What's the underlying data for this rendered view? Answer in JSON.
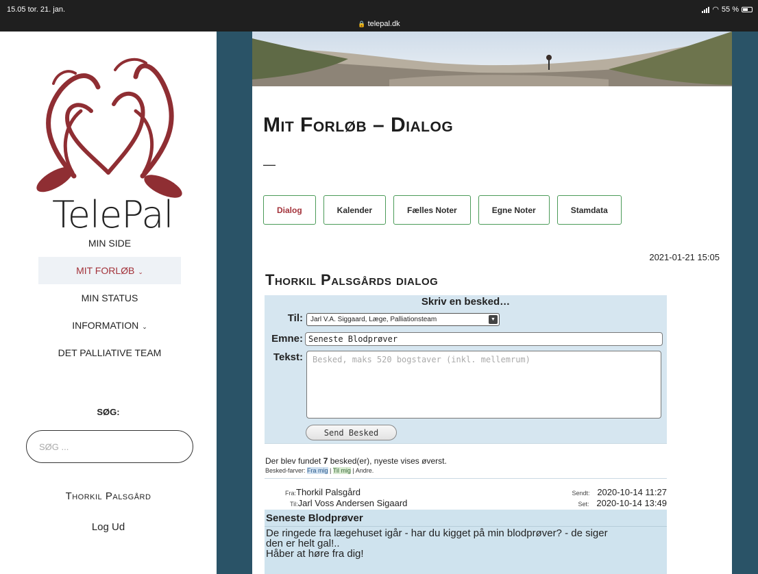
{
  "status_bar": {
    "time": "15.05  tor. 21. jan.",
    "url": "telepal.dk",
    "battery": "55 %"
  },
  "sidebar": {
    "logo_text": "TelePal",
    "nav": [
      {
        "label": "MIN SIDE"
      },
      {
        "label": "MIT FORLØB"
      },
      {
        "label": "MIN STATUS"
      },
      {
        "label": "INFORMATION"
      },
      {
        "label": "DET PALLIATIVE TEAM"
      }
    ],
    "search_label": "SØG:",
    "search_placeholder": "SØG ...",
    "user_name": "Thorkil Palsgård",
    "logout": "Log Ud"
  },
  "page": {
    "title": "Mit Forløb – Dialog",
    "dash": "—",
    "tabs": [
      "Dialog",
      "Kalender",
      "Fælles Noter",
      "Egne Noter",
      "Stamdata"
    ],
    "datetime": "2021-01-21 15:05",
    "dialog_title": "Thorkil Palsgårds dialog"
  },
  "form": {
    "heading": "Skriv en besked…",
    "til_label": "Til:",
    "til_value": "Jarl V.A. Siggaard, Læge, Palliationsteam",
    "emne_label": "Emne:",
    "emne_value": "Seneste Blodprøver",
    "tekst_label": "Tekst:",
    "tekst_placeholder": "Besked, maks 520 bogstaver (inkl. mellemrum)",
    "send_label": "Send Besked"
  },
  "messages_info": {
    "found_prefix": "Der blev fundet ",
    "found_count": "7",
    "found_suffix": " besked(er), nyeste vises øverst.",
    "colors_prefix": "Besked-farver: ",
    "color_from": "Fra mig",
    "color_sep1": " | ",
    "color_to": "Til mig",
    "color_sep2": " | Andre."
  },
  "message": {
    "from_label": "Fra:",
    "from": "Thorkil Palsgård",
    "to_label": "Til:",
    "to": "Jarl Voss Andersen Sigaard",
    "sent_label": "Sendt:",
    "sent": "2020-10-14 11:27",
    "seen_label": "Set:",
    "seen": "2020-10-14 13:49",
    "subject": "Seneste Blodprøver",
    "body": "De ringede fra lægehuset igår - har du kigget på min blodprøver? - de siger\nden er helt gal!..\nHåber at høre fra dig!"
  }
}
